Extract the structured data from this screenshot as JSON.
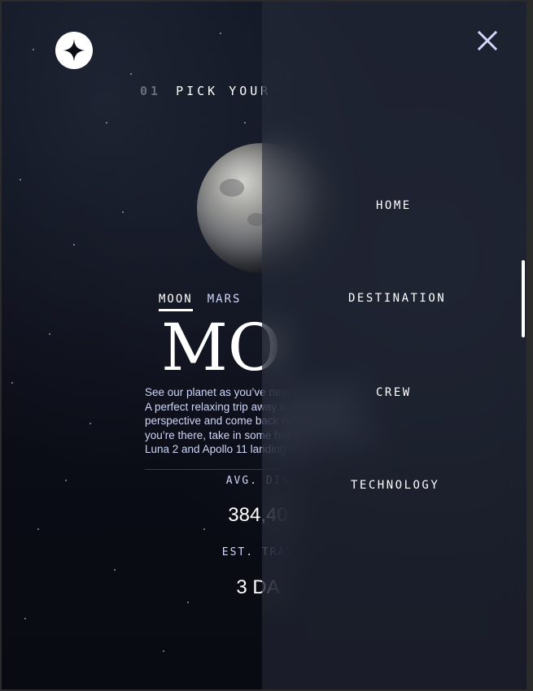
{
  "header": {
    "logo_icon": "star-logo-icon"
  },
  "page": {
    "heading_number": "01",
    "heading_text": "PICK YOUR"
  },
  "planet": {
    "image": "moon-image",
    "tabs": [
      "MOON",
      "MARS"
    ],
    "active_tab": "MOON",
    "name": "MO",
    "description": "See our planet as you’ve never seen it before. A perfect relaxing trip away to help regain perspective and come back refreshed. While you’re there, take in some history by visiting the Luna 2 and Apollo 11 landing sites.",
    "distance_label": "AVG. DIS",
    "distance_value": "384,40",
    "travel_label": "EST. TRAV",
    "travel_value": "3 DA"
  },
  "menu": {
    "close_icon": "close-icon",
    "items": [
      "HOME",
      "DESTINATION",
      "CREW",
      "TECHNOLOGY"
    ]
  },
  "colors": {
    "background": "#0b0d17",
    "text_primary": "#ffffff",
    "text_secondary": "#d0d6f9",
    "divider": "#383b4b"
  }
}
